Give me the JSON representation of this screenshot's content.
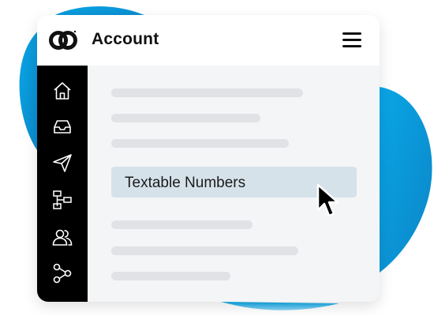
{
  "header": {
    "title": "Account",
    "logo_icon": "chain-link-logo-icon",
    "menu_icon": "hamburger-menu-icon"
  },
  "sidebar": {
    "items": [
      {
        "icon": "home-icon"
      },
      {
        "icon": "inbox-icon"
      },
      {
        "icon": "send-icon"
      },
      {
        "icon": "flowchart-icon"
      },
      {
        "icon": "users-icon"
      },
      {
        "icon": "share-icon"
      }
    ]
  },
  "content": {
    "selected_item": "Textable Numbers"
  },
  "colors": {
    "accent": "#0aa3e0",
    "sidebar_bg": "#000000",
    "highlight_bg": "#d6e2ea",
    "placeholder": "#e1e2e6",
    "content_bg": "#f4f5f7"
  }
}
